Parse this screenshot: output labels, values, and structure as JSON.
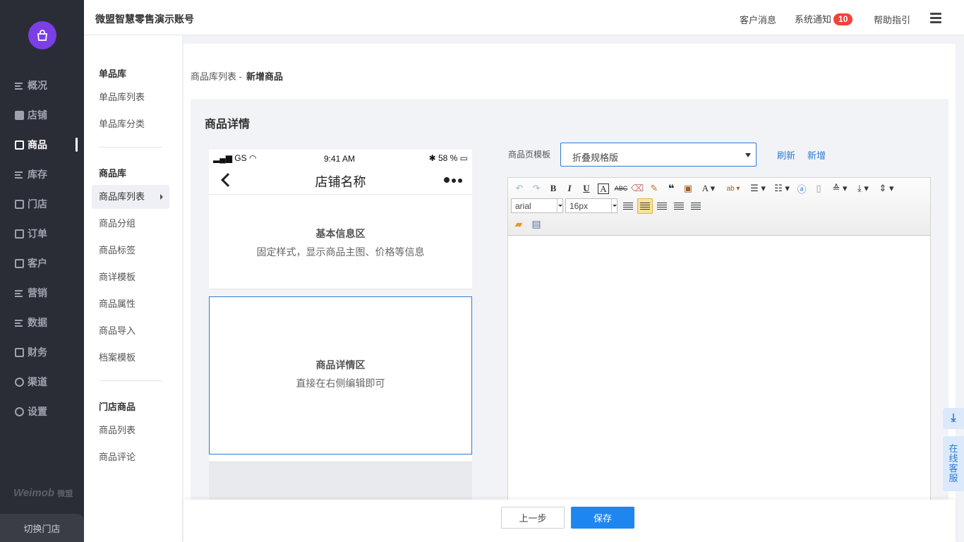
{
  "header": {
    "account": "微盟智慧零售演示账号",
    "messages": "客户消息",
    "notifications": "系统通知",
    "notification_count": "10",
    "help": "帮助指引"
  },
  "nav": {
    "items": [
      {
        "label": "概况",
        "icon": "overview-icon"
      },
      {
        "label": "店铺",
        "icon": "shop-icon"
      },
      {
        "label": "商品",
        "icon": "goods-icon",
        "active": true
      },
      {
        "label": "库存",
        "icon": "stock-icon"
      },
      {
        "label": "门店",
        "icon": "store-icon"
      },
      {
        "label": "订单",
        "icon": "order-icon"
      },
      {
        "label": "客户",
        "icon": "customer-icon"
      },
      {
        "label": "营销",
        "icon": "marketing-icon"
      },
      {
        "label": "数据",
        "icon": "data-icon"
      },
      {
        "label": "财务",
        "icon": "finance-icon"
      },
      {
        "label": "渠道",
        "icon": "channel-icon"
      },
      {
        "label": "设置",
        "icon": "settings-icon"
      }
    ],
    "brand": "Weimob",
    "brand_cn": "微盟",
    "switch_store": "切换门店"
  },
  "subnav": {
    "group1": {
      "title": "单品库",
      "items": [
        "单品库列表",
        "单品库分类"
      ]
    },
    "group2": {
      "title": "商品库",
      "items": [
        "商品库列表",
        "商品分组",
        "商品标签",
        "商详模板",
        "商品属性",
        "商品导入",
        "档案模板"
      ]
    },
    "group3": {
      "title": "门店商品",
      "items": [
        "商品列表",
        "商品评论"
      ]
    }
  },
  "breadcrumb": {
    "parent": "商品库列表 -",
    "current": "新增商品"
  },
  "panel": {
    "title": "商品详情"
  },
  "phone": {
    "carrier": "GS",
    "time": "9:41 AM",
    "battery": "58 %",
    "store_name": "店铺名称",
    "basic_title": "基本信息区",
    "basic_desc": "固定样式，显示商品主图、价格等信息",
    "detail_title": "商品详情区",
    "detail_desc": "直接在右侧编辑即可"
  },
  "template": {
    "label": "商品页模板",
    "selected": "折叠规格版",
    "refresh": "刷新",
    "add": "新增"
  },
  "editor": {
    "font_family": "arial",
    "font_size": "16px",
    "active_tool": "align-left"
  },
  "float": {
    "service": "在线客服"
  },
  "footer": {
    "prev": "上一步",
    "save": "保存"
  },
  "colors": {
    "accent": "#1f86f0",
    "sidebar": "#2a2d35",
    "badge": "#f5423b",
    "logo": "#7b3fe4"
  }
}
